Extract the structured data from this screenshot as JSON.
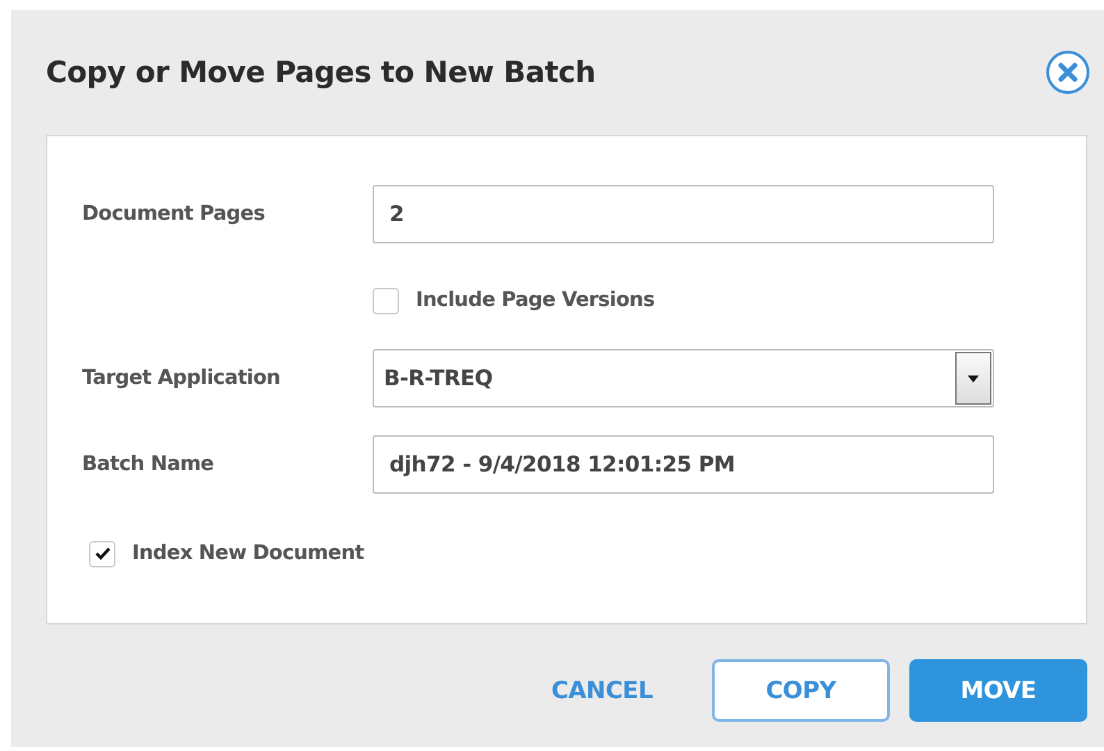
{
  "dialog": {
    "title": "Copy or Move Pages to New Batch"
  },
  "form": [
    {
      "kind": "text",
      "label": "Document Pages",
      "value": "2"
    },
    {
      "kind": "checkbox",
      "label": "Include Page Versions",
      "checked": false
    },
    {
      "kind": "select",
      "label": "Target Application",
      "value": "B-R-TREQ"
    },
    {
      "kind": "text",
      "label": "Batch Name",
      "value": "djh72 - 9/4/2018 12:01:25 PM"
    },
    {
      "kind": "checkbox",
      "label": "Index New Document",
      "checked": true
    }
  ],
  "buttons": [
    {
      "label": "CANCEL",
      "kind": "link"
    },
    {
      "label": "COPY",
      "kind": "outline"
    },
    {
      "label": "MOVE",
      "kind": "primary"
    }
  ]
}
